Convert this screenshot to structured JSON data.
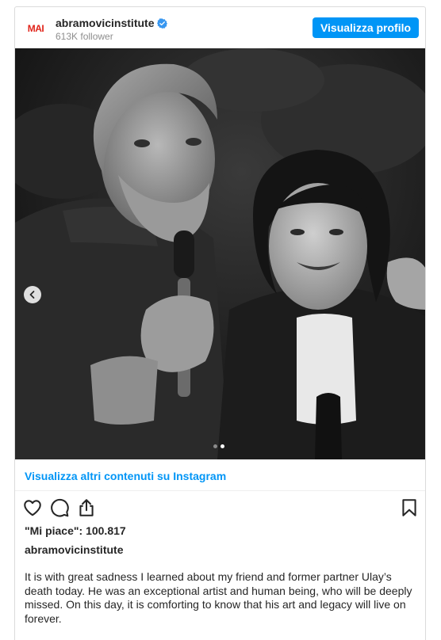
{
  "header": {
    "avatar_logo": "MAI",
    "username": "abramovicinstitute",
    "followers": "613K follower",
    "view_profile_label": "Visualizza profilo"
  },
  "photo": {
    "description_alt": "",
    "carousel_count": 2,
    "carousel_active": 2
  },
  "more_link": "Visualizza altri contenuti su Instagram",
  "likes": "\"Mi piace\": 100.817",
  "caption": {
    "username": "abramovicinstitute",
    "text": "It is with great sadness I learned about my friend and former partner Ulay’s death today. He was an exceptional artist and human being, who will be deeply missed. On this day, it is comforting to know that his art and legacy will live on forever."
  },
  "icons": {
    "verified": "verified-badge-icon",
    "prev": "chevron-left-icon",
    "like": "heart-icon",
    "comment": "comment-icon",
    "share": "share-icon",
    "save": "bookmark-icon"
  },
  "colors": {
    "accent": "#0095f6",
    "logo": "#e1251b",
    "text": "#262626",
    "muted": "#8e8e8e"
  }
}
